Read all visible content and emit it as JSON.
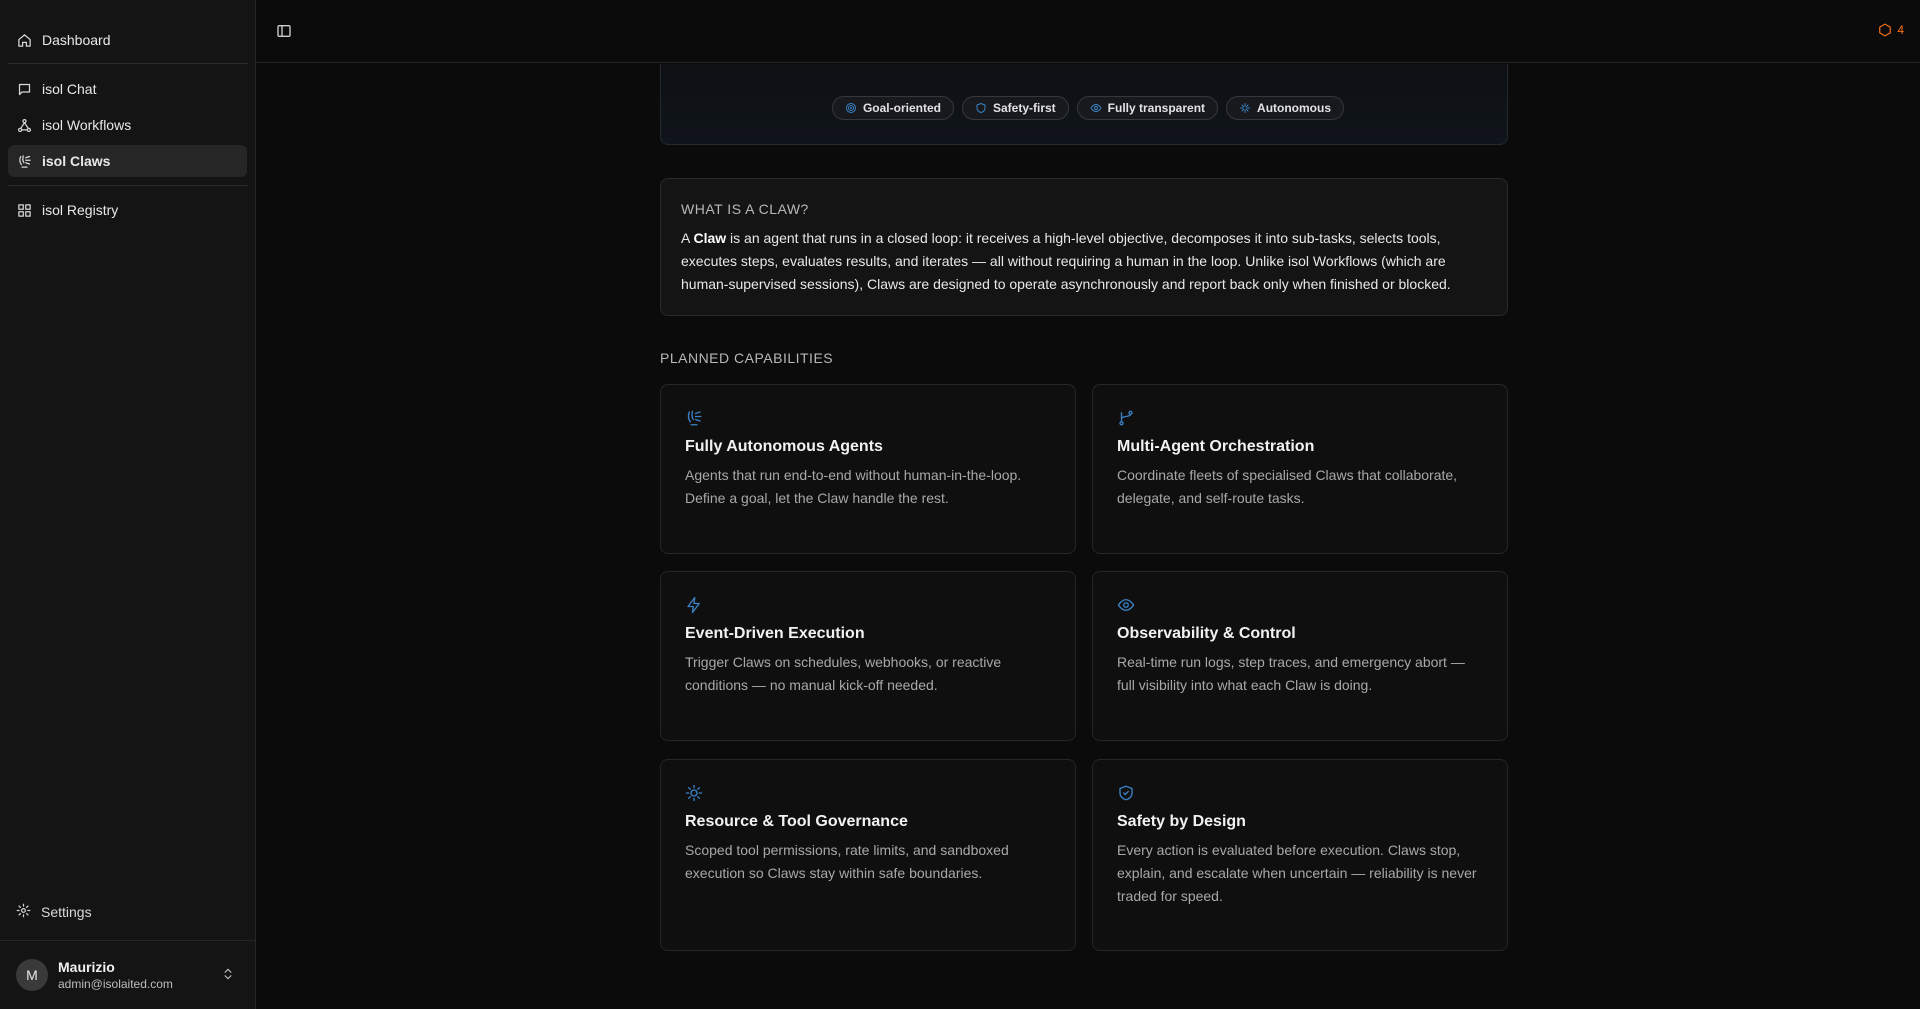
{
  "sidebar": {
    "items": [
      {
        "label": "Dashboard",
        "icon": "home-icon"
      },
      {
        "label": "isol Chat",
        "icon": "chat-icon"
      },
      {
        "label": "isol Workflows",
        "icon": "workflow-icon"
      },
      {
        "label": "isol Claws",
        "icon": "claw-icon",
        "active": true
      },
      {
        "label": "isol Registry",
        "icon": "grid-icon"
      }
    ],
    "settings_label": "Settings",
    "user": {
      "initial": "M",
      "name": "Maurizio",
      "email": "admin@isolaited.com"
    }
  },
  "header": {
    "alert_count": "4"
  },
  "hero": {
    "chips": [
      "Goal-oriented",
      "Safety-first",
      "Fully transparent",
      "Autonomous"
    ]
  },
  "info": {
    "title": "WHAT IS A CLAW?",
    "body_prefix": "A ",
    "body_bold": "Claw",
    "body_rest": " is an agent that runs in a closed loop: it receives a high-level objective, decomposes it into sub-tasks, selects tools, executes steps, evaluates results, and iterates — all without requiring a human in the loop. Unlike isol Workflows (which are human-supervised sessions), Claws are designed to operate asynchronously and report back only when finished or blocked."
  },
  "capabilities": {
    "label": "PLANNED CAPABILITIES",
    "items": [
      {
        "icon": "claw-icon",
        "title": "Fully Autonomous Agents",
        "desc": "Agents that run end-to-end without human-in-the-loop. Define a goal, let the Claw handle the rest."
      },
      {
        "icon": "branch-icon",
        "title": "Multi-Agent Orchestration",
        "desc": "Coordinate fleets of specialised Claws that collaborate, delegate, and self-route tasks."
      },
      {
        "icon": "lightning-icon",
        "title": "Event-Driven Execution",
        "desc": "Trigger Claws on schedules, webhooks, or reactive conditions — no manual kick-off needed."
      },
      {
        "icon": "eye-icon",
        "title": "Observability & Control",
        "desc": "Real-time run logs, step traces, and emergency abort — full visibility into what each Claw is doing."
      },
      {
        "icon": "cog-icon",
        "title": "Resource & Tool Governance",
        "desc": "Scoped tool permissions, rate limits, and sandboxed execution so Claws stay within safe boundaries."
      },
      {
        "icon": "shield-check-icon",
        "title": "Safety by Design",
        "desc": "Every action is evaluated before execution. Claws stop, explain, and escalate when uncertain — reliability is never traded for speed."
      }
    ]
  },
  "colors": {
    "accent": "#3b82c4",
    "alert": "#f97316"
  }
}
